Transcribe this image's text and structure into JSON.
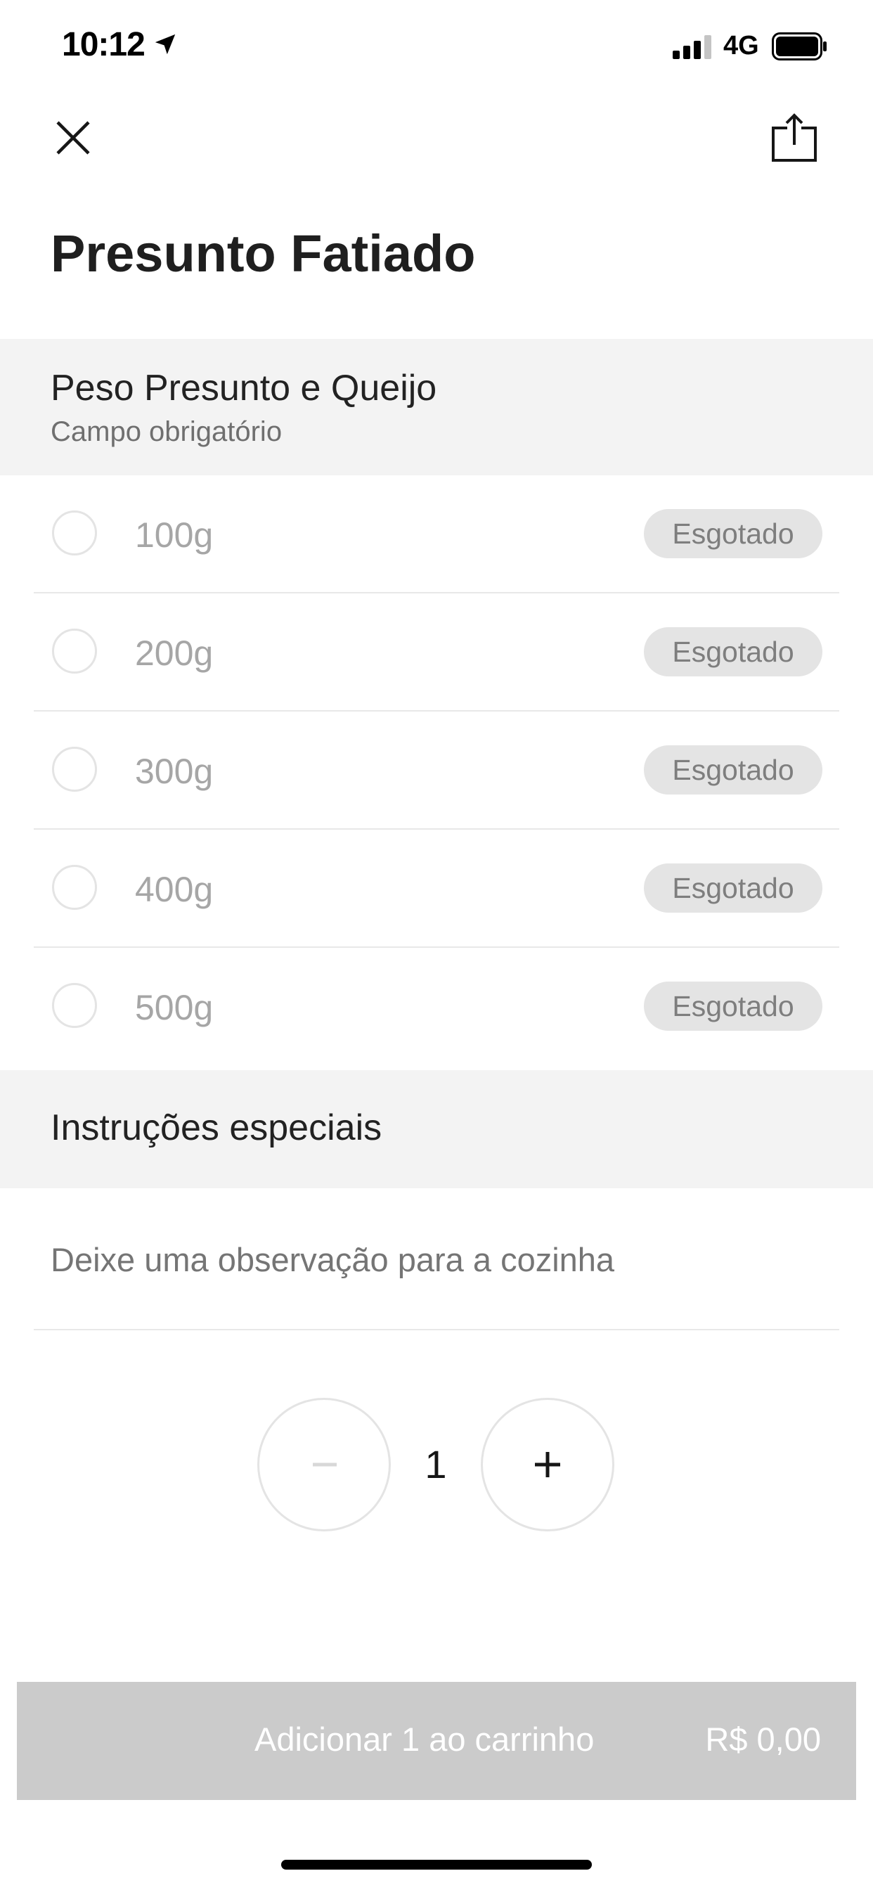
{
  "status_bar": {
    "time": "10:12",
    "network": "4G"
  },
  "header": {
    "title": "Presunto Fatiado"
  },
  "weight_section": {
    "title": "Peso Presunto e Queijo",
    "subtitle": "Campo obrigatório",
    "options": [
      {
        "label": "100g",
        "badge": "Esgotado"
      },
      {
        "label": "200g",
        "badge": "Esgotado"
      },
      {
        "label": "300g",
        "badge": "Esgotado"
      },
      {
        "label": "400g",
        "badge": "Esgotado"
      },
      {
        "label": "500g",
        "badge": "Esgotado"
      }
    ]
  },
  "instructions": {
    "title": "Instruções especiais",
    "placeholder": "Deixe uma observação para a cozinha"
  },
  "quantity": {
    "value": "1"
  },
  "cart": {
    "label": "Adicionar 1 ao carrinho",
    "price": "R$ 0,00"
  },
  "icons": {
    "close": "close-icon",
    "share": "share-icon",
    "location": "location-arrow-icon",
    "signal": "signal-icon",
    "battery": "battery-icon",
    "minus": "minus-icon",
    "plus": "plus-icon"
  },
  "colors": {
    "section_bg": "#f3f3f3",
    "badge_bg": "#e4e4e4",
    "cart_bg": "#cbcbcb"
  }
}
